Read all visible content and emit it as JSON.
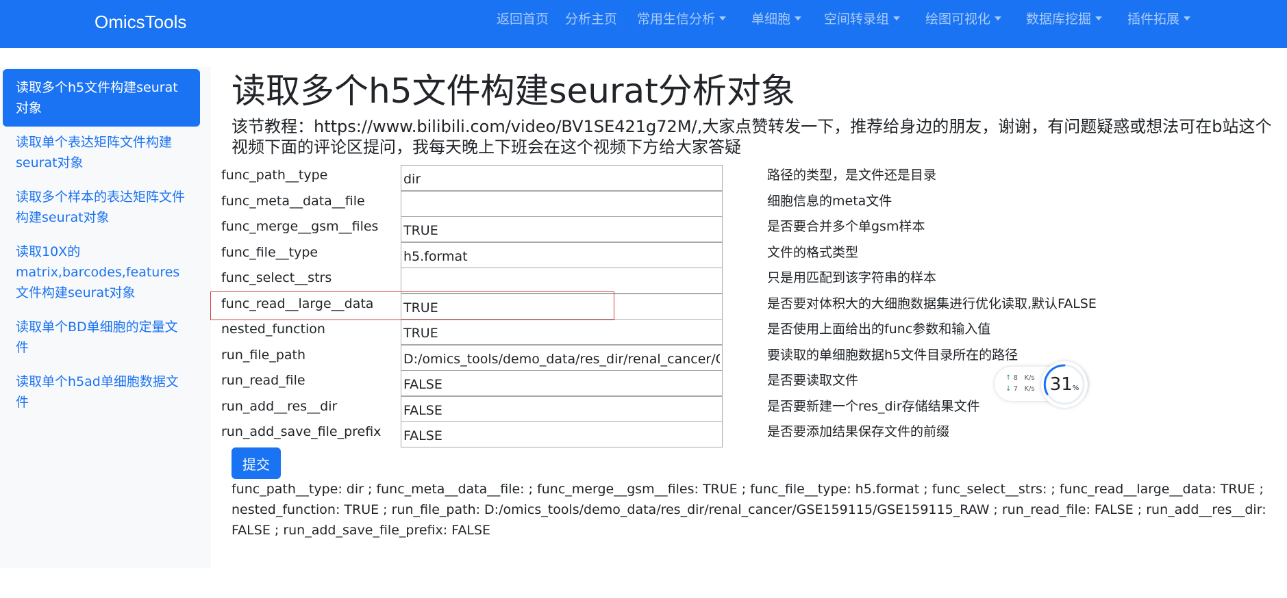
{
  "navbar": {
    "brand": "OmicsTools",
    "items": [
      {
        "label": "返回首页",
        "dropdown": false
      },
      {
        "label": "分析主页",
        "dropdown": false
      },
      {
        "label": "常用生信分析",
        "dropdown": true
      },
      {
        "label": "单细胞",
        "dropdown": true
      },
      {
        "label": "空间转录组",
        "dropdown": true
      },
      {
        "label": "绘图可视化",
        "dropdown": true
      },
      {
        "label": "数据库挖掘",
        "dropdown": true
      },
      {
        "label": "插件拓展",
        "dropdown": true
      }
    ]
  },
  "sidebar": {
    "items": [
      {
        "label": "读取多个h5文件构建seurat对象",
        "active": true
      },
      {
        "label": "读取单个表达矩阵文件构建seurat对象",
        "active": false
      },
      {
        "label": "读取多个样本的表达矩阵文件构建seurat对象",
        "active": false
      },
      {
        "label": "读取10X的matrix,barcodes,features文件构建seurat对象",
        "active": false
      },
      {
        "label": "读取单个BD单细胞的定量文件",
        "active": false
      },
      {
        "label": "读取单个h5ad单细胞数据文件",
        "active": false
      }
    ]
  },
  "main": {
    "title": "读取多个h5文件构建seurat分析对象",
    "description": "该节教程：https://www.bilibili.com/video/BV1SE421g72M/,大家点赞转发一下，推荐给身边的朋友，谢谢，有问题疑惑或想法可在b站这个视频下面的评论区提问，我每天晚上下班会在这个视频下方给大家答疑",
    "params": [
      {
        "name": "func_path__type",
        "value": "dir",
        "desc": "路径的类型，是文件还是目录"
      },
      {
        "name": "func_meta__data__file",
        "value": "",
        "desc": "细胞信息的meta文件"
      },
      {
        "name": "func_merge__gsm__files",
        "value": "TRUE",
        "desc": "是否要合并多个单gsm样本"
      },
      {
        "name": "func_file__type",
        "value": "h5.format",
        "desc": "文件的格式类型"
      },
      {
        "name": "func_select__strs",
        "value": "",
        "desc": "只是用匹配到该字符串的样本"
      },
      {
        "name": "func_read__large__data",
        "value": "TRUE",
        "desc": "是否要对体积大的大细胞数据集进行优化读取,默认FALSE"
      },
      {
        "name": "nested_function",
        "value": "TRUE",
        "desc": "是否使用上面给出的func参数和输入值"
      },
      {
        "name": "run_file_path",
        "value": "D:/omics_tools/demo_data/res_dir/renal_cancer/GSE159115/GSE159115_RAW",
        "desc": "要读取的单细胞数据h5文件目录所在的路径"
      },
      {
        "name": "run_read_file",
        "value": "FALSE",
        "desc": "是否要读取文件"
      },
      {
        "name": "run_add__res__dir",
        "value": "FALSE",
        "desc": "是否要新建一个res_dir存储结果文件"
      },
      {
        "name": "run_add_save_file_prefix",
        "value": "FALSE",
        "desc": "是否要添加结果保存文件的前缀"
      }
    ],
    "submit_label": "提交",
    "summary": "func_path__type: dir ; func_meta__data__file: ; func_merge__gsm__files: TRUE ; func_file__type: h5.format ; func_select__strs: ; func_read__large__data: TRUE ; nested_function: TRUE ; run_file_path: D:/omics_tools/demo_data/res_dir/renal_cancer/GSE159115/GSE159115_RAW ; run_read_file: FALSE ; run_add__res__dir: FALSE ; run_add_save_file_prefix: FALSE"
  },
  "net_widget": {
    "up_value": "8",
    "down_value": "7",
    "unit": "K/s",
    "percent": "31",
    "percent_sign": "%"
  },
  "colors": {
    "primary": "#1a73f2",
    "highlight_border": "#d23c3c",
    "sidebar_bg": "#f8f9fa"
  }
}
